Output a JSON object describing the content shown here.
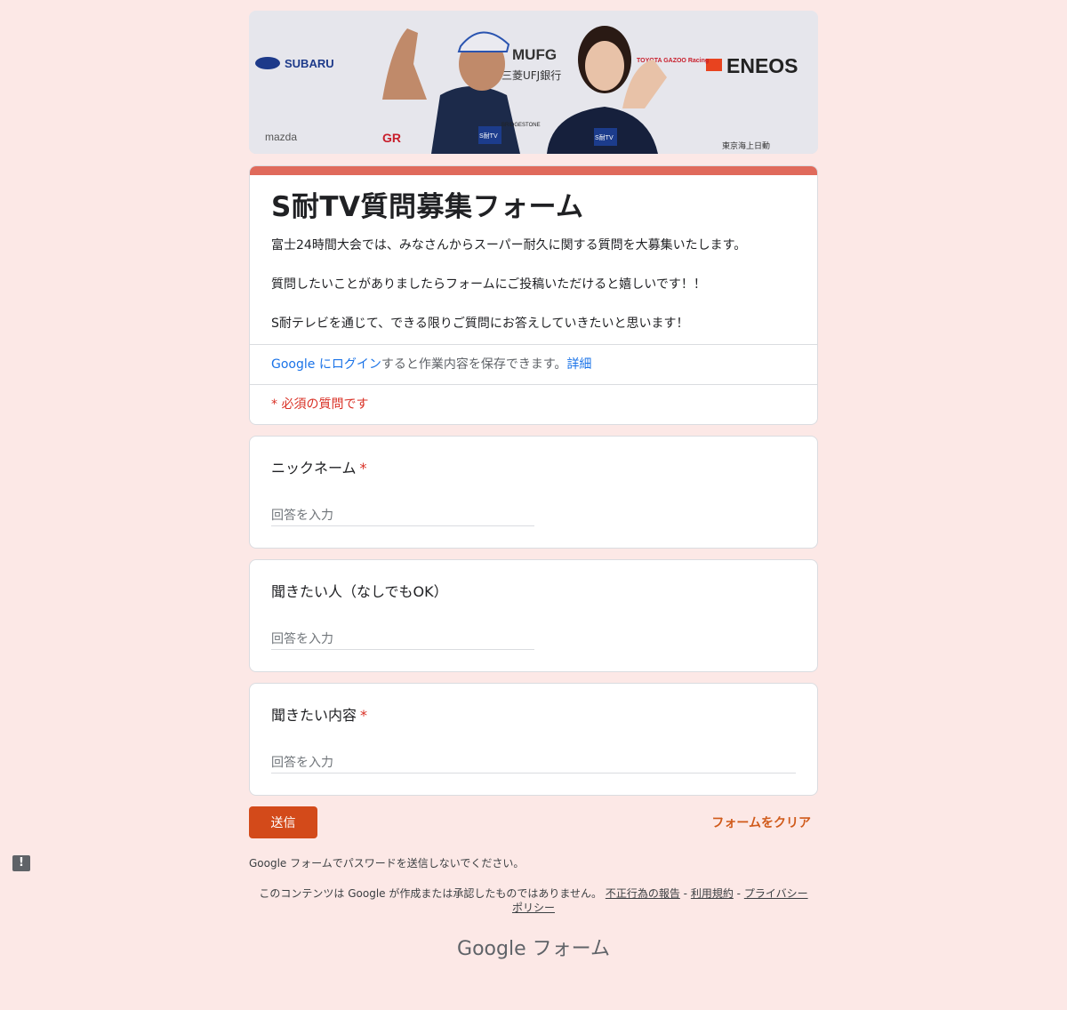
{
  "banner": {
    "sponsors": [
      "SUBARU",
      "mazda",
      "MUFG",
      "三菱UFJ銀行",
      "TOYOTA GAZOO Racing",
      "ENEOS",
      "GR",
      "BRIDGESTONE",
      "東京海上日動"
    ],
    "mic_label": "S耐TV"
  },
  "form": {
    "title": "S耐TV質問募集フォーム",
    "description": [
      "富士24時間大会では、みなさんからスーパー耐久に関する質問を大募集いたします。",
      "質問したいことがありましたらフォームにご投稿いただけると嬉しいです！！",
      "S耐テレビを通じて、できる限りご質問にお答えしていきたいと思います！"
    ],
    "login_link": "Google にログイン",
    "login_text": "すると作業内容を保存できます。",
    "details_link": "詳細",
    "required_note": "* 必須の質問です"
  },
  "questions": [
    {
      "label": "ニックネーム",
      "required": "*",
      "placeholder": "回答を入力"
    },
    {
      "label": "聞きたい人（なしでもOK）",
      "placeholder": "回答を入力"
    },
    {
      "label": "聞きたい内容",
      "required": "*",
      "placeholder": "回答を入力"
    }
  ],
  "actions": {
    "submit": "送信",
    "clear": "フォームをクリア"
  },
  "notice": "Google フォームでパスワードを送信しないでください。",
  "footer": {
    "disclaimer": "このコンテンツは Google が作成または承認したものではありません。",
    "abuse": "不正行為の報告",
    "sep": " - ",
    "terms": "利用規約",
    "privacy1": "プライバシー",
    "privacy2": "ポリシー"
  },
  "brand": "Google フォーム",
  "report_icon": "!"
}
